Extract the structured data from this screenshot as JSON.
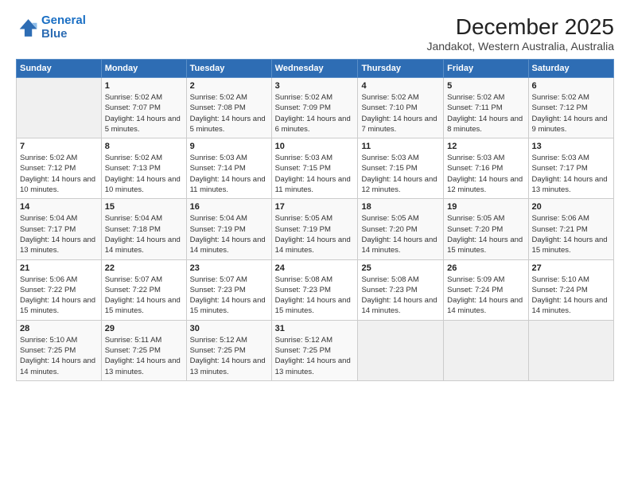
{
  "logo": {
    "line1": "General",
    "line2": "Blue"
  },
  "title": "December 2025",
  "subtitle": "Jandakot, Western Australia, Australia",
  "days_header": [
    "Sunday",
    "Monday",
    "Tuesday",
    "Wednesday",
    "Thursday",
    "Friday",
    "Saturday"
  ],
  "weeks": [
    [
      {
        "day": "",
        "sunrise": "",
        "sunset": "",
        "daylight": ""
      },
      {
        "day": "1",
        "sunrise": "Sunrise: 5:02 AM",
        "sunset": "Sunset: 7:07 PM",
        "daylight": "Daylight: 14 hours and 5 minutes."
      },
      {
        "day": "2",
        "sunrise": "Sunrise: 5:02 AM",
        "sunset": "Sunset: 7:08 PM",
        "daylight": "Daylight: 14 hours and 5 minutes."
      },
      {
        "day": "3",
        "sunrise": "Sunrise: 5:02 AM",
        "sunset": "Sunset: 7:09 PM",
        "daylight": "Daylight: 14 hours and 6 minutes."
      },
      {
        "day": "4",
        "sunrise": "Sunrise: 5:02 AM",
        "sunset": "Sunset: 7:10 PM",
        "daylight": "Daylight: 14 hours and 7 minutes."
      },
      {
        "day": "5",
        "sunrise": "Sunrise: 5:02 AM",
        "sunset": "Sunset: 7:11 PM",
        "daylight": "Daylight: 14 hours and 8 minutes."
      },
      {
        "day": "6",
        "sunrise": "Sunrise: 5:02 AM",
        "sunset": "Sunset: 7:12 PM",
        "daylight": "Daylight: 14 hours and 9 minutes."
      }
    ],
    [
      {
        "day": "7",
        "sunrise": "Sunrise: 5:02 AM",
        "sunset": "Sunset: 7:12 PM",
        "daylight": "Daylight: 14 hours and 10 minutes."
      },
      {
        "day": "8",
        "sunrise": "Sunrise: 5:02 AM",
        "sunset": "Sunset: 7:13 PM",
        "daylight": "Daylight: 14 hours and 10 minutes."
      },
      {
        "day": "9",
        "sunrise": "Sunrise: 5:03 AM",
        "sunset": "Sunset: 7:14 PM",
        "daylight": "Daylight: 14 hours and 11 minutes."
      },
      {
        "day": "10",
        "sunrise": "Sunrise: 5:03 AM",
        "sunset": "Sunset: 7:15 PM",
        "daylight": "Daylight: 14 hours and 11 minutes."
      },
      {
        "day": "11",
        "sunrise": "Sunrise: 5:03 AM",
        "sunset": "Sunset: 7:15 PM",
        "daylight": "Daylight: 14 hours and 12 minutes."
      },
      {
        "day": "12",
        "sunrise": "Sunrise: 5:03 AM",
        "sunset": "Sunset: 7:16 PM",
        "daylight": "Daylight: 14 hours and 12 minutes."
      },
      {
        "day": "13",
        "sunrise": "Sunrise: 5:03 AM",
        "sunset": "Sunset: 7:17 PM",
        "daylight": "Daylight: 14 hours and 13 minutes."
      }
    ],
    [
      {
        "day": "14",
        "sunrise": "Sunrise: 5:04 AM",
        "sunset": "Sunset: 7:17 PM",
        "daylight": "Daylight: 14 hours and 13 minutes."
      },
      {
        "day": "15",
        "sunrise": "Sunrise: 5:04 AM",
        "sunset": "Sunset: 7:18 PM",
        "daylight": "Daylight: 14 hours and 14 minutes."
      },
      {
        "day": "16",
        "sunrise": "Sunrise: 5:04 AM",
        "sunset": "Sunset: 7:19 PM",
        "daylight": "Daylight: 14 hours and 14 minutes."
      },
      {
        "day": "17",
        "sunrise": "Sunrise: 5:05 AM",
        "sunset": "Sunset: 7:19 PM",
        "daylight": "Daylight: 14 hours and 14 minutes."
      },
      {
        "day": "18",
        "sunrise": "Sunrise: 5:05 AM",
        "sunset": "Sunset: 7:20 PM",
        "daylight": "Daylight: 14 hours and 14 minutes."
      },
      {
        "day": "19",
        "sunrise": "Sunrise: 5:05 AM",
        "sunset": "Sunset: 7:20 PM",
        "daylight": "Daylight: 14 hours and 15 minutes."
      },
      {
        "day": "20",
        "sunrise": "Sunrise: 5:06 AM",
        "sunset": "Sunset: 7:21 PM",
        "daylight": "Daylight: 14 hours and 15 minutes."
      }
    ],
    [
      {
        "day": "21",
        "sunrise": "Sunrise: 5:06 AM",
        "sunset": "Sunset: 7:22 PM",
        "daylight": "Daylight: 14 hours and 15 minutes."
      },
      {
        "day": "22",
        "sunrise": "Sunrise: 5:07 AM",
        "sunset": "Sunset: 7:22 PM",
        "daylight": "Daylight: 14 hours and 15 minutes."
      },
      {
        "day": "23",
        "sunrise": "Sunrise: 5:07 AM",
        "sunset": "Sunset: 7:23 PM",
        "daylight": "Daylight: 14 hours and 15 minutes."
      },
      {
        "day": "24",
        "sunrise": "Sunrise: 5:08 AM",
        "sunset": "Sunset: 7:23 PM",
        "daylight": "Daylight: 14 hours and 15 minutes."
      },
      {
        "day": "25",
        "sunrise": "Sunrise: 5:08 AM",
        "sunset": "Sunset: 7:23 PM",
        "daylight": "Daylight: 14 hours and 14 minutes."
      },
      {
        "day": "26",
        "sunrise": "Sunrise: 5:09 AM",
        "sunset": "Sunset: 7:24 PM",
        "daylight": "Daylight: 14 hours and 14 minutes."
      },
      {
        "day": "27",
        "sunrise": "Sunrise: 5:10 AM",
        "sunset": "Sunset: 7:24 PM",
        "daylight": "Daylight: 14 hours and 14 minutes."
      }
    ],
    [
      {
        "day": "28",
        "sunrise": "Sunrise: 5:10 AM",
        "sunset": "Sunset: 7:25 PM",
        "daylight": "Daylight: 14 hours and 14 minutes."
      },
      {
        "day": "29",
        "sunrise": "Sunrise: 5:11 AM",
        "sunset": "Sunset: 7:25 PM",
        "daylight": "Daylight: 14 hours and 13 minutes."
      },
      {
        "day": "30",
        "sunrise": "Sunrise: 5:12 AM",
        "sunset": "Sunset: 7:25 PM",
        "daylight": "Daylight: 14 hours and 13 minutes."
      },
      {
        "day": "31",
        "sunrise": "Sunrise: 5:12 AM",
        "sunset": "Sunset: 7:25 PM",
        "daylight": "Daylight: 14 hours and 13 minutes."
      },
      {
        "day": "",
        "sunrise": "",
        "sunset": "",
        "daylight": ""
      },
      {
        "day": "",
        "sunrise": "",
        "sunset": "",
        "daylight": ""
      },
      {
        "day": "",
        "sunrise": "",
        "sunset": "",
        "daylight": ""
      }
    ]
  ]
}
